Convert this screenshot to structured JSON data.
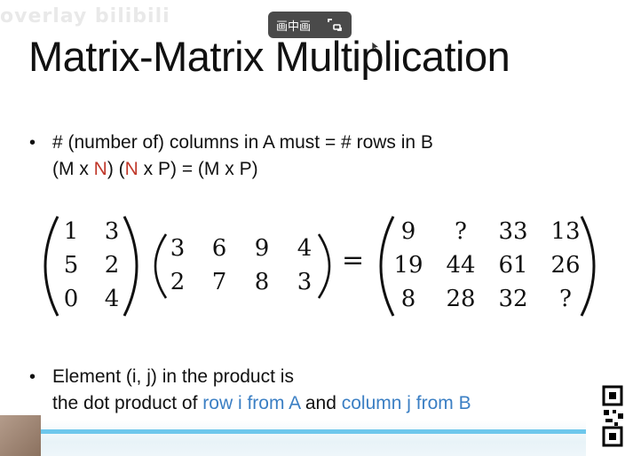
{
  "overlay": {
    "watermark": "overlay bilibili",
    "pip_label": "画中画",
    "pip_icon": "pip-icon",
    "expand_icon": "expand-icon"
  },
  "slide": {
    "title": "Matrix-Matrix Multiplication",
    "bullet1": {
      "line1": "# (number of) columns in A must = # rows in B",
      "line2_parts": [
        "(M x ",
        "N",
        ") (",
        "N",
        " x P) = (M x P)"
      ]
    },
    "matrix_a": [
      [
        "1",
        "3"
      ],
      [
        "5",
        "2"
      ],
      [
        "0",
        "4"
      ]
    ],
    "matrix_b": [
      [
        "3",
        "6",
        "9",
        "4"
      ],
      [
        "2",
        "7",
        "8",
        "3"
      ]
    ],
    "equals": "=",
    "matrix_c": [
      [
        "9",
        "?",
        "33",
        "13"
      ],
      [
        "19",
        "44",
        "61",
        "26"
      ],
      [
        "8",
        "28",
        "32",
        "?"
      ]
    ],
    "bullet2": {
      "line1": "Element (i, j) in the product is",
      "line2_prefix": "the dot product of ",
      "row_text": "row i from A",
      "and_text": " and ",
      "col_text": "column j from B"
    },
    "bullet_char": "•"
  },
  "player": {
    "progress_fraction": 0.94,
    "accent_color": "#6ec7ec",
    "highlight_color": "#c0392b",
    "link_color": "#3b7fc4"
  }
}
